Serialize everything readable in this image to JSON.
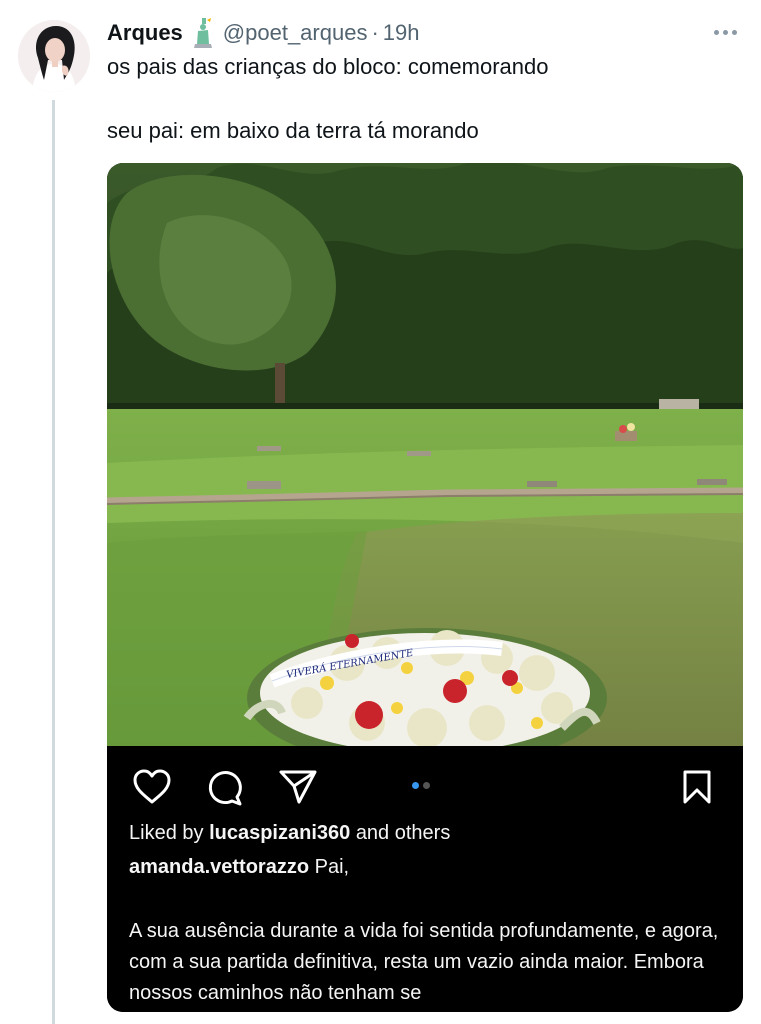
{
  "tweet": {
    "author_name": "Arques",
    "handle": "@poet_arques",
    "separator": "·",
    "time": "19h",
    "text_line1": "os pais das crianças do bloco: comemorando",
    "text_line2": "seu pai: em baixo da terra tá morando"
  },
  "icons": {
    "author_badge": "statue-of-liberty-emoji",
    "more": "more-options-icon",
    "like": "heart-icon",
    "comment": "comment-icon",
    "share": "send-icon",
    "save": "bookmark-icon"
  },
  "instagram": {
    "liked_prefix": "Liked by",
    "liked_user": "lucaspizani360",
    "liked_suffix": "and others",
    "caption_user": "amanda.vettorazzo",
    "caption_start": "Pai,",
    "caption_body": "A sua ausência durante a vida foi sentida profundamente, e agora, com a sua partida definitiva, resta um vazio ainda maior. Embora nossos caminhos não tenham se",
    "carousel_active": 1,
    "carousel_total": 2,
    "ribbon_text": "VIVERÁ ETERNAMENTE"
  },
  "colors": {
    "text_primary": "#0f1419",
    "text_secondary": "#536471",
    "thread_line": "#cfd9de",
    "ig_background": "#000000",
    "carousel_active": "#3797f0"
  }
}
